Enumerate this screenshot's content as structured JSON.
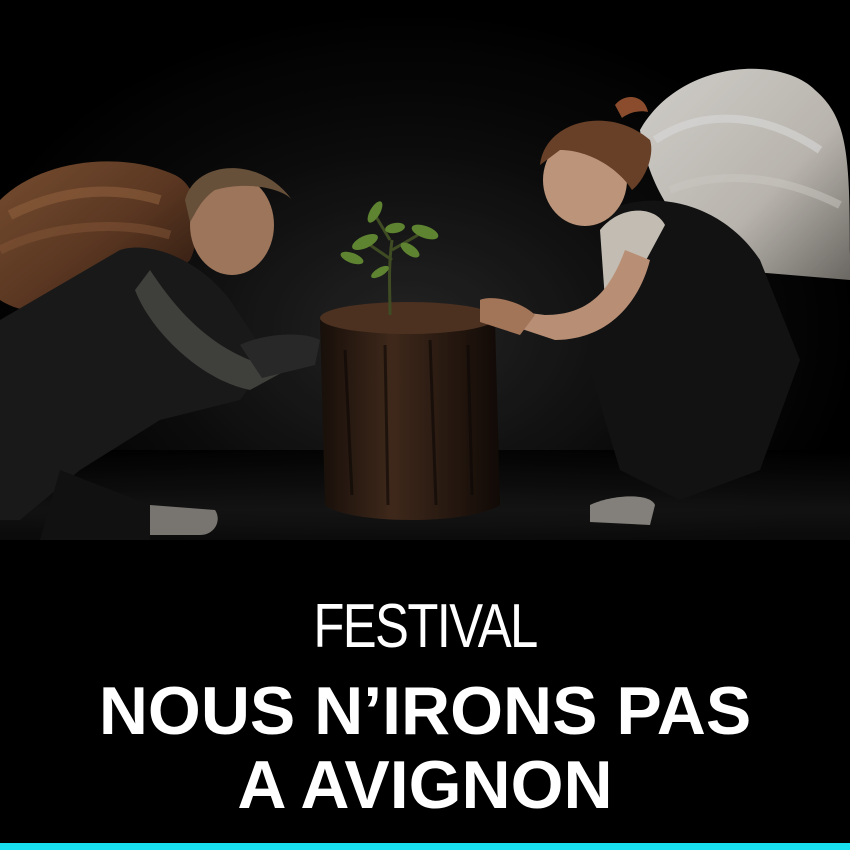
{
  "poster": {
    "kicker": "FESTIVAL",
    "title_line1": "NOUS N’IRONS PAS",
    "title_line2": "A AVIGNON"
  },
  "colors": {
    "background": "#000000",
    "text": "#ffffff",
    "accent_bar": "#19e0f0"
  }
}
